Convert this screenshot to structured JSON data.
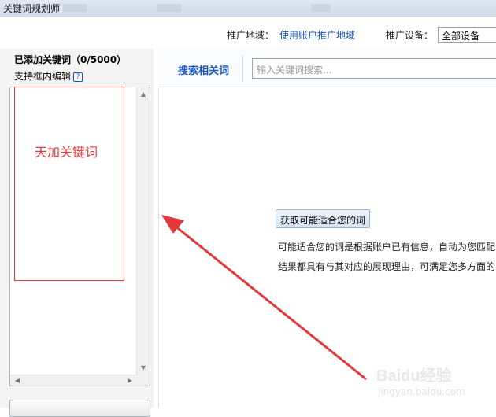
{
  "window": {
    "title": "关键词规划师"
  },
  "filters": {
    "region_label": "推广地域：",
    "region_value": "使用账户推广地域",
    "device_label": "推广设备：",
    "device_value": "全部设备"
  },
  "left_panel": {
    "title": "已添加关键词（0/5000）",
    "subtitle": "支持框内编辑",
    "help_glyph": "?",
    "bottom_button_label": ""
  },
  "right_panel": {
    "tab_label": "搜索相关词",
    "search_placeholder": "输入关键词搜索...",
    "get_button_label": "获取可能适合您的词",
    "desc_line1": "可能适合您的词是根据账户已有信息，自动为您匹配",
    "desc_line2": "结果都具有与其对应的展现理由，可满足您多方面的"
  },
  "annotation": {
    "box_text": "天加关键词",
    "color": "#e2393c"
  },
  "watermark": {
    "brand": "Baidu经验",
    "url": "jingyan.baidu.com"
  },
  "colors": {
    "link": "#1a57b8",
    "annotation": "#e2393c"
  }
}
